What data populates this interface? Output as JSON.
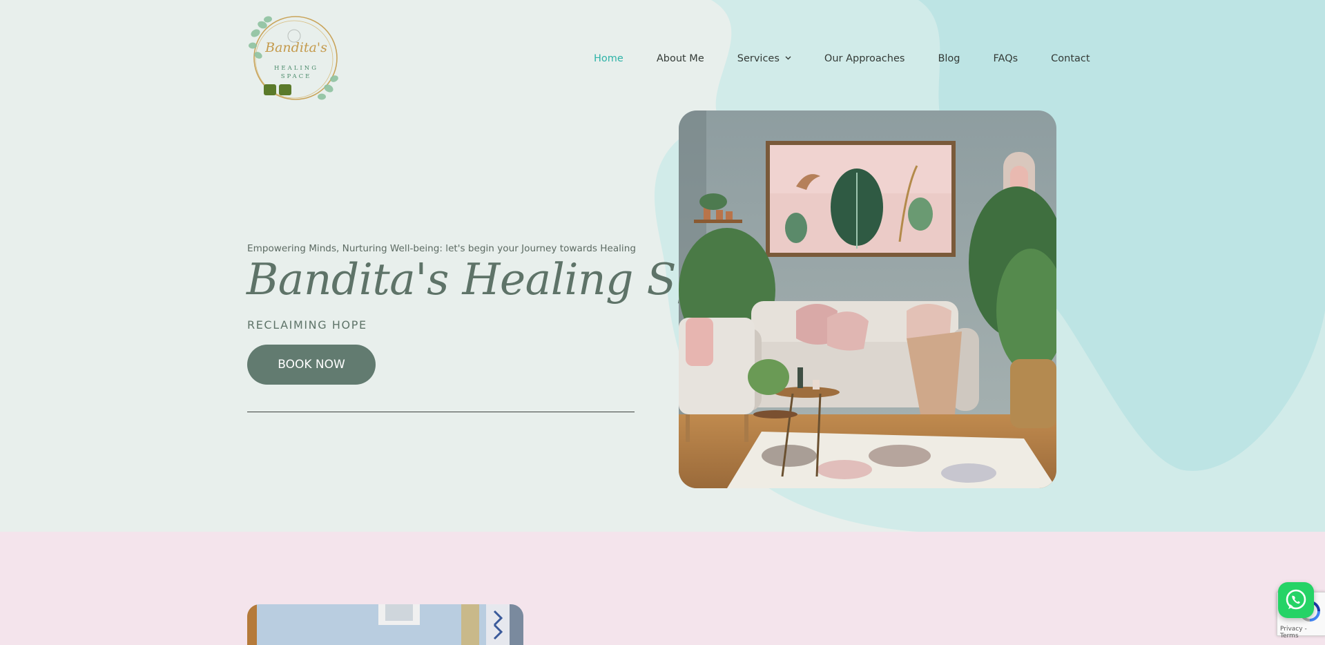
{
  "logo": {
    "script_name": "Bandita's",
    "line1": "HEALING",
    "line2": "SPACE"
  },
  "nav": {
    "items": [
      {
        "label": "Home",
        "active": true
      },
      {
        "label": "About Me"
      },
      {
        "label": "Services",
        "has_dropdown": true
      },
      {
        "label": "Our Approaches"
      },
      {
        "label": "Blog"
      },
      {
        "label": "FAQs"
      },
      {
        "label": "Contact"
      }
    ]
  },
  "hero": {
    "tagline": "Empowering Minds, Nurturing Well-being: let's begin your Journey towards Healing",
    "title": "Bandita's Healing Space",
    "subtitle": "RECLAIMING HOPE",
    "cta_label": "BOOK NOW"
  },
  "recaptcha": {
    "terms": "Privacy - Terms"
  },
  "colors": {
    "accent": "#2eb3a7",
    "button": "#627b70",
    "hero_bg": "#e8efec",
    "blob": "#bde4e4",
    "pink_bg": "#f4e4ec",
    "whatsapp": "#25d366"
  },
  "icons": {
    "whatsapp": "whatsapp-icon",
    "dropdown": "chevron-down-icon",
    "recaptcha": "recaptcha-icon"
  }
}
